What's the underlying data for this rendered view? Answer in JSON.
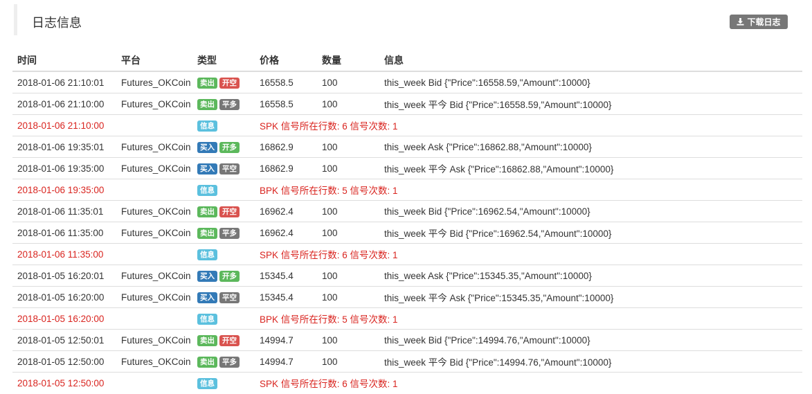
{
  "header": {
    "title": "日志信息",
    "download_label": "下载日志"
  },
  "columns": {
    "time": "时间",
    "platform": "平台",
    "type": "类型",
    "price": "价格",
    "quantity": "数量",
    "info": "信息"
  },
  "colors": {
    "sell": "#5cb85c",
    "buy": "#337ab7",
    "open_short": "#d9534f",
    "open_long": "#5cb85c",
    "close": "#777777",
    "info": "#5bc0de",
    "signal_text": "#d9241f"
  },
  "rows": [
    {
      "kind": "trade",
      "time": "2018-01-06 21:10:01",
      "platform": "Futures_OKCoin",
      "side": "卖出",
      "side_class": "sell",
      "action": "开空",
      "action_class": "open-short",
      "price": "16558.5",
      "quantity": "100",
      "info": "this_week Bid {\"Price\":16558.59,\"Amount\":10000}"
    },
    {
      "kind": "trade",
      "time": "2018-01-06 21:10:00",
      "platform": "Futures_OKCoin",
      "side": "卖出",
      "side_class": "sell",
      "action": "平多",
      "action_class": "close",
      "price": "16558.5",
      "quantity": "100",
      "info": "this_week 平今 Bid {\"Price\":16558.59,\"Amount\":10000}"
    },
    {
      "kind": "signal",
      "time": "2018-01-06 21:10:00",
      "badge": "信息",
      "info": "SPK 信号所在行数: 6 信号次数: 1"
    },
    {
      "kind": "trade",
      "time": "2018-01-06 19:35:01",
      "platform": "Futures_OKCoin",
      "side": "买入",
      "side_class": "buy",
      "action": "开多",
      "action_class": "open-long",
      "price": "16862.9",
      "quantity": "100",
      "info": "this_week Ask {\"Price\":16862.88,\"Amount\":10000}"
    },
    {
      "kind": "trade",
      "time": "2018-01-06 19:35:00",
      "platform": "Futures_OKCoin",
      "side": "买入",
      "side_class": "buy",
      "action": "平空",
      "action_class": "close",
      "price": "16862.9",
      "quantity": "100",
      "info": "this_week 平今 Ask {\"Price\":16862.88,\"Amount\":10000}"
    },
    {
      "kind": "signal",
      "time": "2018-01-06 19:35:00",
      "badge": "信息",
      "info": "BPK 信号所在行数: 5 信号次数: 1"
    },
    {
      "kind": "trade",
      "time": "2018-01-06 11:35:01",
      "platform": "Futures_OKCoin",
      "side": "卖出",
      "side_class": "sell",
      "action": "开空",
      "action_class": "open-short",
      "price": "16962.4",
      "quantity": "100",
      "info": "this_week Bid {\"Price\":16962.54,\"Amount\":10000}"
    },
    {
      "kind": "trade",
      "time": "2018-01-06 11:35:00",
      "platform": "Futures_OKCoin",
      "side": "卖出",
      "side_class": "sell",
      "action": "平多",
      "action_class": "close",
      "price": "16962.4",
      "quantity": "100",
      "info": "this_week 平今 Bid {\"Price\":16962.54,\"Amount\":10000}"
    },
    {
      "kind": "signal",
      "time": "2018-01-06 11:35:00",
      "badge": "信息",
      "info": "SPK 信号所在行数: 6 信号次数: 1"
    },
    {
      "kind": "trade",
      "time": "2018-01-05 16:20:01",
      "platform": "Futures_OKCoin",
      "side": "买入",
      "side_class": "buy",
      "action": "开多",
      "action_class": "open-long",
      "price": "15345.4",
      "quantity": "100",
      "info": "this_week Ask {\"Price\":15345.35,\"Amount\":10000}"
    },
    {
      "kind": "trade",
      "time": "2018-01-05 16:20:00",
      "platform": "Futures_OKCoin",
      "side": "买入",
      "side_class": "buy",
      "action": "平空",
      "action_class": "close",
      "price": "15345.4",
      "quantity": "100",
      "info": "this_week 平今 Ask {\"Price\":15345.35,\"Amount\":10000}"
    },
    {
      "kind": "signal",
      "time": "2018-01-05 16:20:00",
      "badge": "信息",
      "info": "BPK 信号所在行数: 5 信号次数: 1"
    },
    {
      "kind": "trade",
      "time": "2018-01-05 12:50:01",
      "platform": "Futures_OKCoin",
      "side": "卖出",
      "side_class": "sell",
      "action": "开空",
      "action_class": "open-short",
      "price": "14994.7",
      "quantity": "100",
      "info": "this_week Bid {\"Price\":14994.76,\"Amount\":10000}"
    },
    {
      "kind": "trade",
      "time": "2018-01-05 12:50:00",
      "platform": "Futures_OKCoin",
      "side": "卖出",
      "side_class": "sell",
      "action": "平多",
      "action_class": "close",
      "price": "14994.7",
      "quantity": "100",
      "info": "this_week 平今 Bid {\"Price\":14994.76,\"Amount\":10000}"
    },
    {
      "kind": "signal",
      "time": "2018-01-05 12:50:00",
      "badge": "信息",
      "info": "SPK 信号所在行数: 6 信号次数: 1"
    }
  ]
}
